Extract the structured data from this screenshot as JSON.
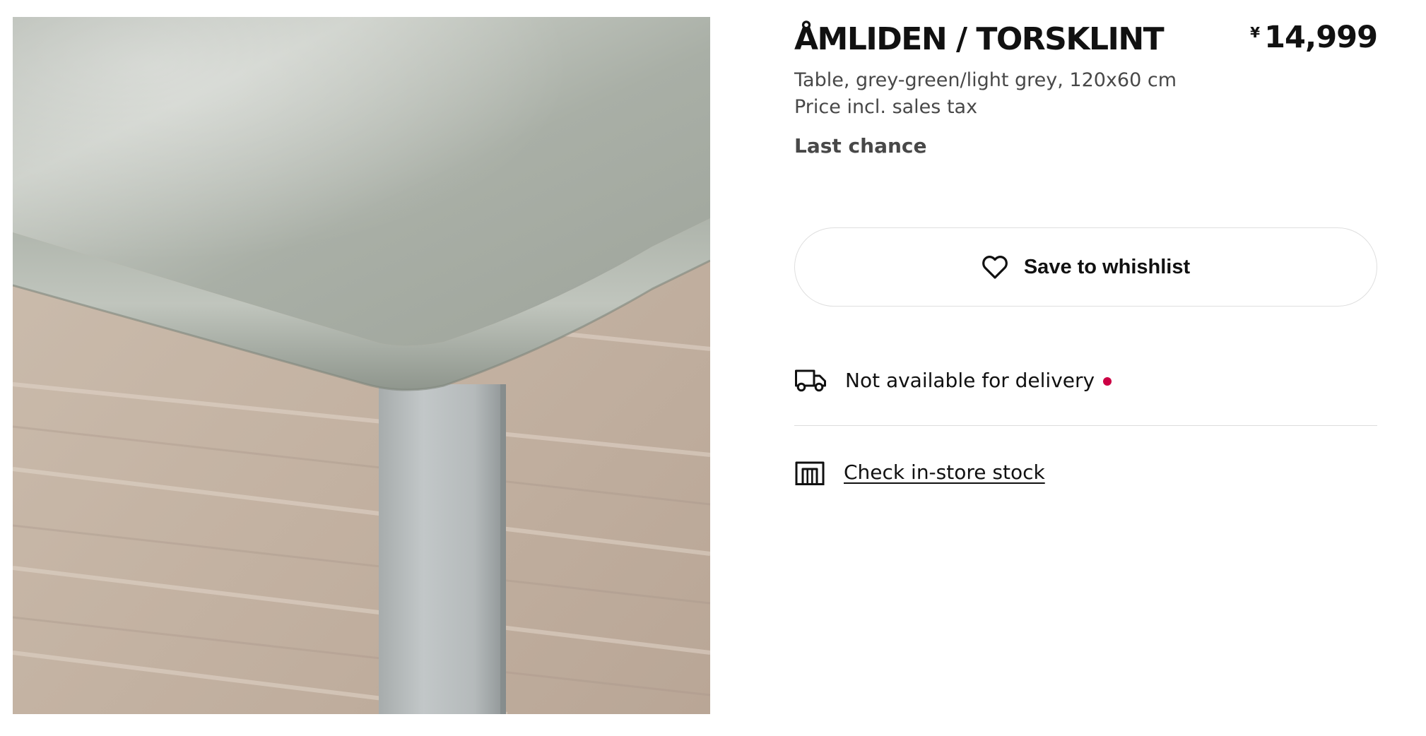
{
  "product": {
    "name": "ÅMLIDEN / TORSKLINT",
    "currency_symbol": "¥",
    "price": "14,999",
    "description": "Table, grey-green/light grey, 120x60 cm",
    "tax_note": "Price incl. sales tax",
    "badge": "Last chance",
    "image_icon": "table-corner-photo"
  },
  "actions": {
    "wishlist_label": "Save to whishlist",
    "wishlist_icon": "heart-icon"
  },
  "availability": {
    "delivery_text": "Not available for delivery",
    "delivery_icon": "truck-icon",
    "delivery_status_color": "#cc0044",
    "stock_link_text": "Check in-store stock",
    "stock_icon": "store-icon"
  },
  "colors": {
    "text_primary": "#111111",
    "text_secondary": "#484848",
    "border": "#dfdfdf",
    "status_unavailable": "#cc0044"
  }
}
